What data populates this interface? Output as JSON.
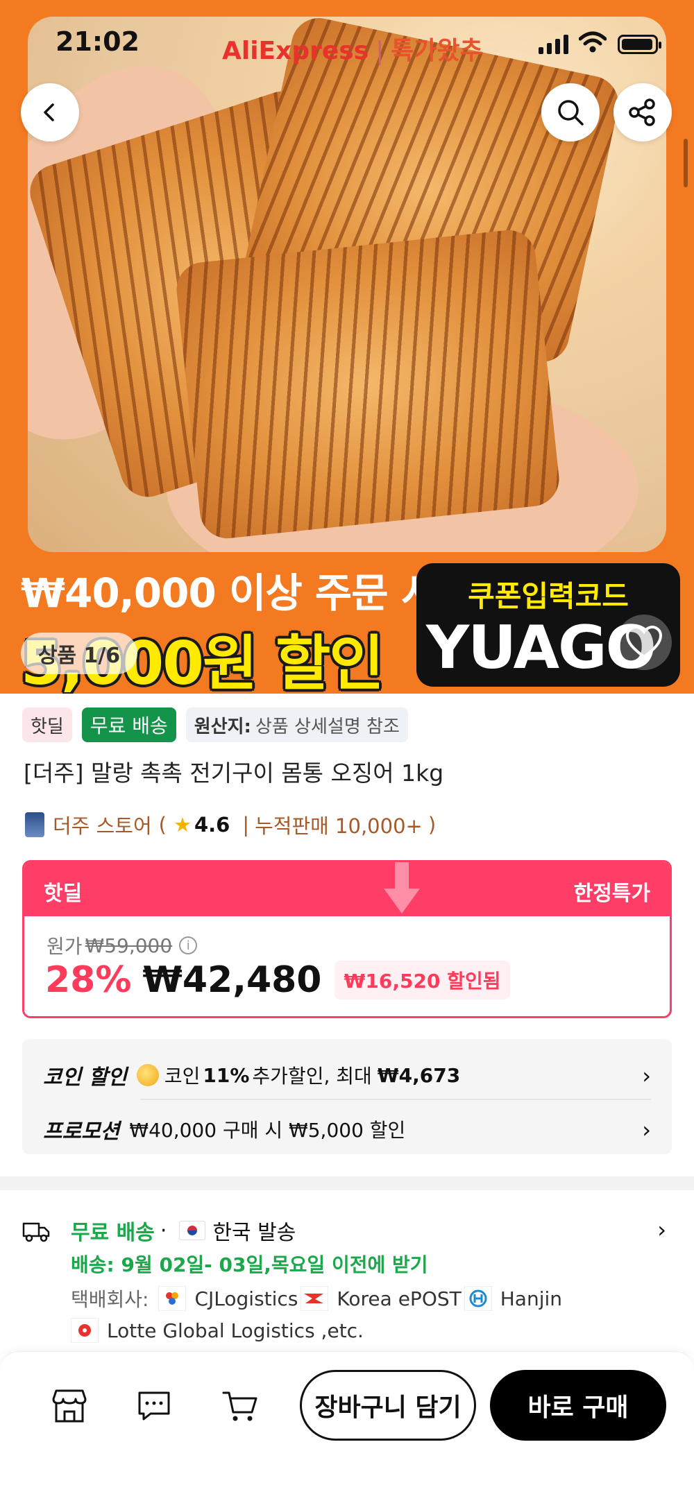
{
  "status_bar": {
    "time": "21:02"
  },
  "brand": {
    "name": "AliExpress",
    "divider": "|",
    "campaign": "특가왔추"
  },
  "hero": {
    "promo_line1": "₩40,000 이상 주문 시",
    "promo_line2": "5,000원 할인",
    "coupon_label": "쿠폰입력코드",
    "coupon_code": "YUAGO",
    "counter": "상품 1/6"
  },
  "badges": {
    "hot": "핫딜",
    "free_shipping": "무료 배송",
    "origin_label": "원산지:",
    "origin_value": "상품 상세설명 참조"
  },
  "product": {
    "title": "[더주] 말랑 촉촉 전기구이 몸통 오징어 1kg"
  },
  "store": {
    "name": "더주 스토어",
    "open": "(",
    "rating": "4.6",
    "sep": "|",
    "sales": "누적판매 10,000+",
    "close": ")"
  },
  "price": {
    "header_left": "핫딜",
    "header_right": "한정특가",
    "original_label": "원가",
    "original_price": "₩59,000",
    "discount_pct": "28%",
    "current_price": "₩42,480",
    "saved": "₩16,520 할인됨"
  },
  "coin": {
    "label": "코인 할인",
    "text_prefix": "코인",
    "pct": "11%",
    "text_mid": "추가할인, 최대",
    "max": "₩4,673"
  },
  "promotion": {
    "label": "프로모션",
    "text": "₩40,000 구매 시 ₩5,000 할인"
  },
  "shipping": {
    "free": "무료 배송",
    "dot": "·",
    "origin": "한국 발송",
    "delivery": "배송: 9월 02일- 03일,목요일 이전에 받기",
    "courier_label": "택배회사:",
    "couriers": [
      "CJLogistics",
      "Korea ePOST",
      "Hanjin",
      "Lotte Global Logistics ,etc."
    ]
  },
  "bottom_bar": {
    "add_to_cart": "장바구니 담기",
    "buy_now": "바로 구매"
  },
  "colors": {
    "brand_orange": "#f47a22",
    "hot_pink": "#ff3e68",
    "green": "#1aa84a",
    "promo_yellow": "#ffea00"
  }
}
